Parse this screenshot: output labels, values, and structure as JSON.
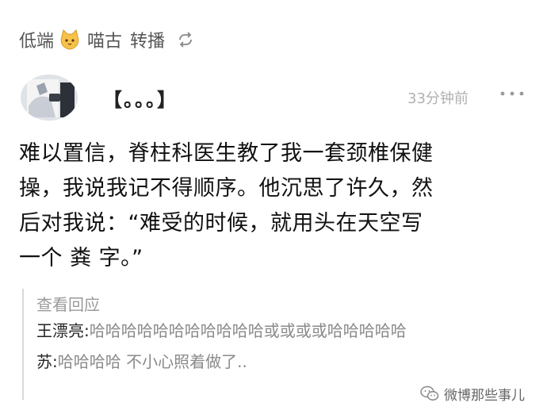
{
  "repost": {
    "user_prefix": "低端",
    "cat_icon": "cat-face-emoji",
    "user_suffix": "喵古",
    "action": "转播",
    "repost_icon": "repost-icon"
  },
  "post": {
    "title": "【。。。】",
    "time": "33分钟前",
    "more_icon": "more-dots-icon",
    "body_lines": [
      "难以置信，脊柱科医生教了我一套颈椎保健",
      "操，我说我记不得顺序。他沉思了许久，然",
      "后对我说：“难受的时候，就用头在天空写",
      "一个 粪 字。”"
    ]
  },
  "replies": {
    "header": "查看回应",
    "items": [
      {
        "author": "王漂亮:",
        "text": "哈哈哈哈哈哈哈哈哈哈哈或或或或哈哈哈哈哈"
      },
      {
        "author": "苏:",
        "text": "哈哈哈哈  不小心照着做了.."
      }
    ]
  },
  "watermark": {
    "text": "微博那些事儿",
    "icon": "wechat-icon"
  },
  "colors": {
    "meta_gray": "#b0b0b0",
    "reply_gray": "#8a8a8a",
    "divider": "#d9d9d9"
  }
}
